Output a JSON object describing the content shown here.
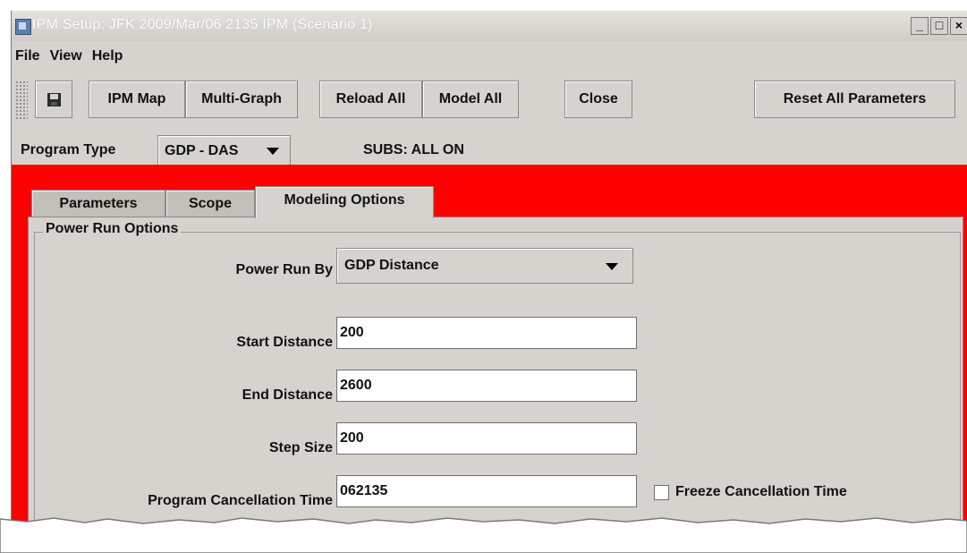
{
  "window": {
    "title": "IPM Setup: JFK 2009/Mar/06 2135 IPM (Scenario 1)",
    "controls": {
      "minimize": "_",
      "maximize": "□",
      "close": "×"
    }
  },
  "menu": {
    "items": [
      {
        "label": "File"
      },
      {
        "label": "View"
      },
      {
        "label": "Help"
      }
    ]
  },
  "toolbar": {
    "save_icon": "floppy-disk-icon",
    "ipm_map": "IPM Map",
    "multi_graph": "Multi-Graph",
    "reload_all": "Reload All",
    "model_all": "Model All",
    "close": "Close",
    "reset_all": "Reset All Parameters"
  },
  "program": {
    "label": "Program Type",
    "selected": "GDP - DAS",
    "subs": "SUBS: ALL ON"
  },
  "tabs": [
    {
      "label": "Parameters"
    },
    {
      "label": "Scope"
    },
    {
      "label": "Modeling Options"
    }
  ],
  "active_tab": "Modeling Options",
  "power_run": {
    "group_title": "Power Run Options",
    "by_label": "Power Run By",
    "by_value": "GDP Distance",
    "start_label": "Start Distance",
    "start_value": "200",
    "end_label": "End Distance",
    "end_value": "2600",
    "step_label": "Step Size",
    "step_value": "200",
    "cancel_label": "Program Cancellation Time",
    "cancel_value": "062135",
    "freeze_label": "Freeze Cancellation Time",
    "freeze_checked": false
  },
  "colors": {
    "highlight": "#ff0000",
    "panel": "#d6d3ce"
  }
}
